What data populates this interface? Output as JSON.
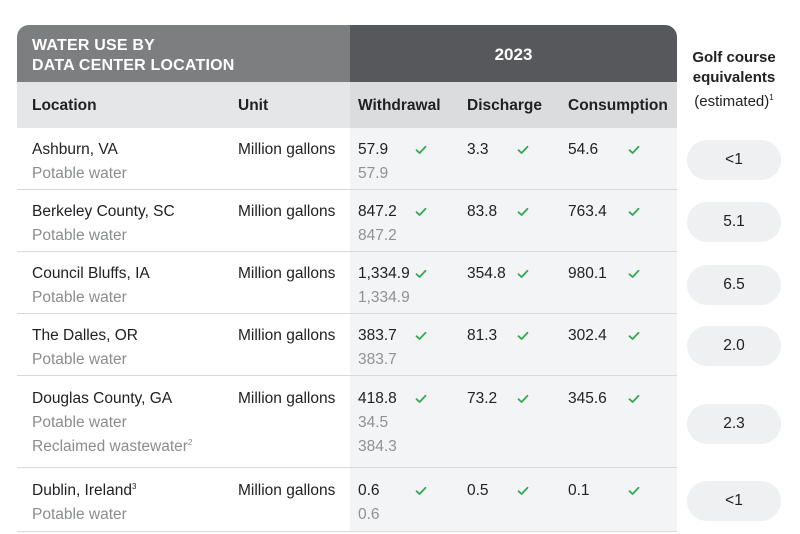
{
  "header": {
    "title_line1": "WATER USE BY",
    "title_line2": "DATA CENTER LOCATION",
    "year": "2023"
  },
  "columns": {
    "location": "Location",
    "unit": "Unit",
    "withdrawal": "Withdrawal",
    "discharge": "Discharge",
    "consumption": "Consumption"
  },
  "golf": {
    "line1": "Golf course",
    "line2": "equivalents",
    "line3": "(estimated)",
    "footnote": "1"
  },
  "check_color": "#34a853",
  "rows": [
    {
      "location": "Ashburn, VA",
      "loc_note": "",
      "subs": [
        "Potable water"
      ],
      "sub_notes": [
        ""
      ],
      "unit": "Million gallons",
      "withdrawal": "57.9",
      "withdrawal_subs": [
        "57.9"
      ],
      "discharge": "3.3",
      "consumption": "54.6",
      "golf": "<1"
    },
    {
      "location": "Berkeley County, SC",
      "loc_note": "",
      "subs": [
        "Potable water"
      ],
      "sub_notes": [
        ""
      ],
      "unit": "Million gallons",
      "withdrawal": "847.2",
      "withdrawal_subs": [
        "847.2"
      ],
      "discharge": "83.8",
      "consumption": "763.4",
      "golf": "5.1"
    },
    {
      "location": "Council Bluffs, IA",
      "loc_note": "",
      "subs": [
        "Potable water"
      ],
      "sub_notes": [
        ""
      ],
      "unit": "Million gallons",
      "withdrawal": "1,334.9",
      "withdrawal_subs": [
        "1,334.9"
      ],
      "discharge": "354.8",
      "consumption": "980.1",
      "golf": "6.5"
    },
    {
      "location": "The Dalles, OR",
      "loc_note": "",
      "subs": [
        "Potable water"
      ],
      "sub_notes": [
        ""
      ],
      "unit": "Million gallons",
      "withdrawal": "383.7",
      "withdrawal_subs": [
        "383.7"
      ],
      "discharge": "81.3",
      "consumption": "302.4",
      "golf": "2.0"
    },
    {
      "location": "Douglas County, GA",
      "loc_note": "",
      "subs": [
        "Potable water",
        "Reclaimed wastewater"
      ],
      "sub_notes": [
        "",
        "2"
      ],
      "unit": "Million gallons",
      "withdrawal": "418.8",
      "withdrawal_subs": [
        "34.5",
        "384.3"
      ],
      "discharge": "73.2",
      "consumption": "345.6",
      "golf": "2.3"
    },
    {
      "location": "Dublin, Ireland",
      "loc_note": "3",
      "subs": [
        "Potable water"
      ],
      "sub_notes": [
        ""
      ],
      "unit": "Million gallons",
      "withdrawal": "0.6",
      "withdrawal_subs": [
        "0.6"
      ],
      "discharge": "0.5",
      "consumption": "0.1",
      "golf": "<1"
    }
  ]
}
